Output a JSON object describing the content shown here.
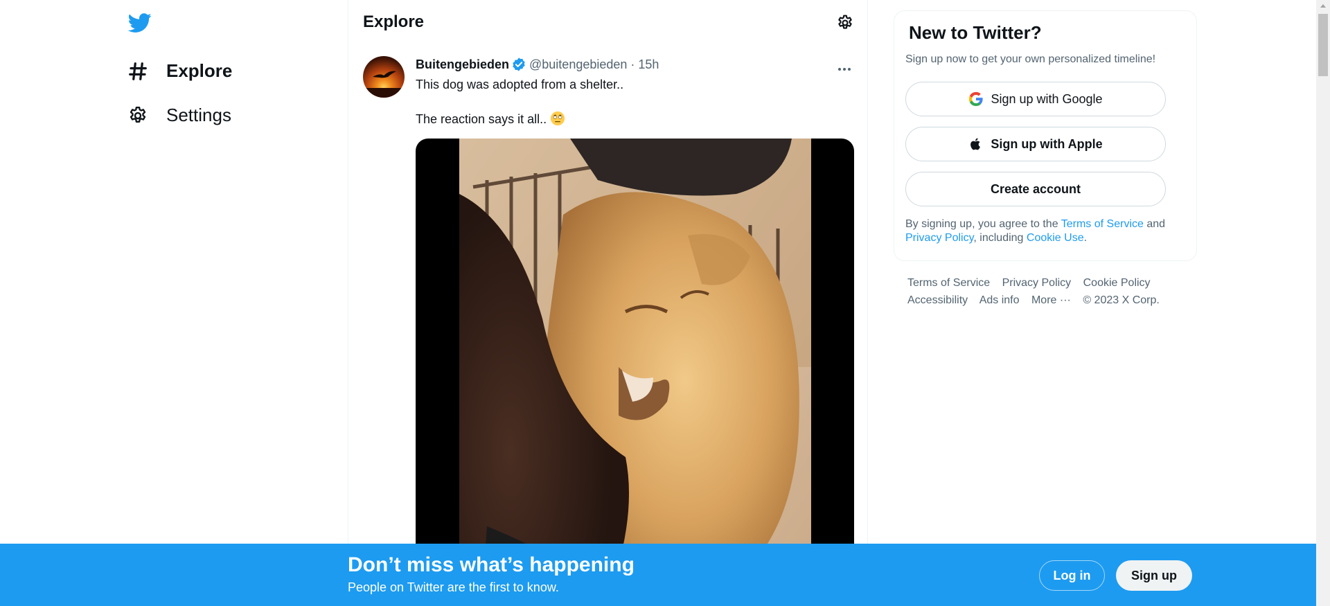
{
  "nav": {
    "logo": "twitter-bird-icon",
    "items": [
      {
        "label": "Explore",
        "icon": "hashtag-icon"
      },
      {
        "label": "Settings",
        "icon": "gear-icon"
      }
    ]
  },
  "main": {
    "title": "Explore",
    "settings_icon": "gear-icon"
  },
  "tweet": {
    "author_name": "Buitengebieden",
    "verified": true,
    "handle": "@buitengebieden",
    "separator": "·",
    "time": "15h",
    "text_line1": "This dog was adopted from a shelter..",
    "text_line2": "The reaction says it all..",
    "media": "video-dog-being-hugged"
  },
  "signup": {
    "title": "New to Twitter?",
    "subtitle": "Sign up now to get your own personalized timeline!",
    "google_label": "Sign up with Google",
    "apple_label": "Sign up with Apple",
    "create_label": "Create account",
    "terms_prefix": "By signing up, you agree to the",
    "terms_link": "Terms of Service",
    "terms_and": "and",
    "privacy_link": "Privacy Policy",
    "terms_including": ", including",
    "cookie_link": "Cookie Use",
    "terms_end": "."
  },
  "footer": {
    "terms": "Terms of Service",
    "privacy": "Privacy Policy",
    "cookie": "Cookie Policy",
    "accessibility": "Accessibility",
    "ads": "Ads info",
    "more": "More ···",
    "copyright": "© 2023 X Corp."
  },
  "banner": {
    "title": "Don’t miss what’s happening",
    "subtitle": "People on Twitter are the first to know.",
    "login_label": "Log in",
    "signup_label": "Sign up"
  },
  "colors": {
    "accent": "#1d9bf0",
    "text": "#0f1419",
    "muted": "#536471",
    "border": "#cfd9de"
  }
}
